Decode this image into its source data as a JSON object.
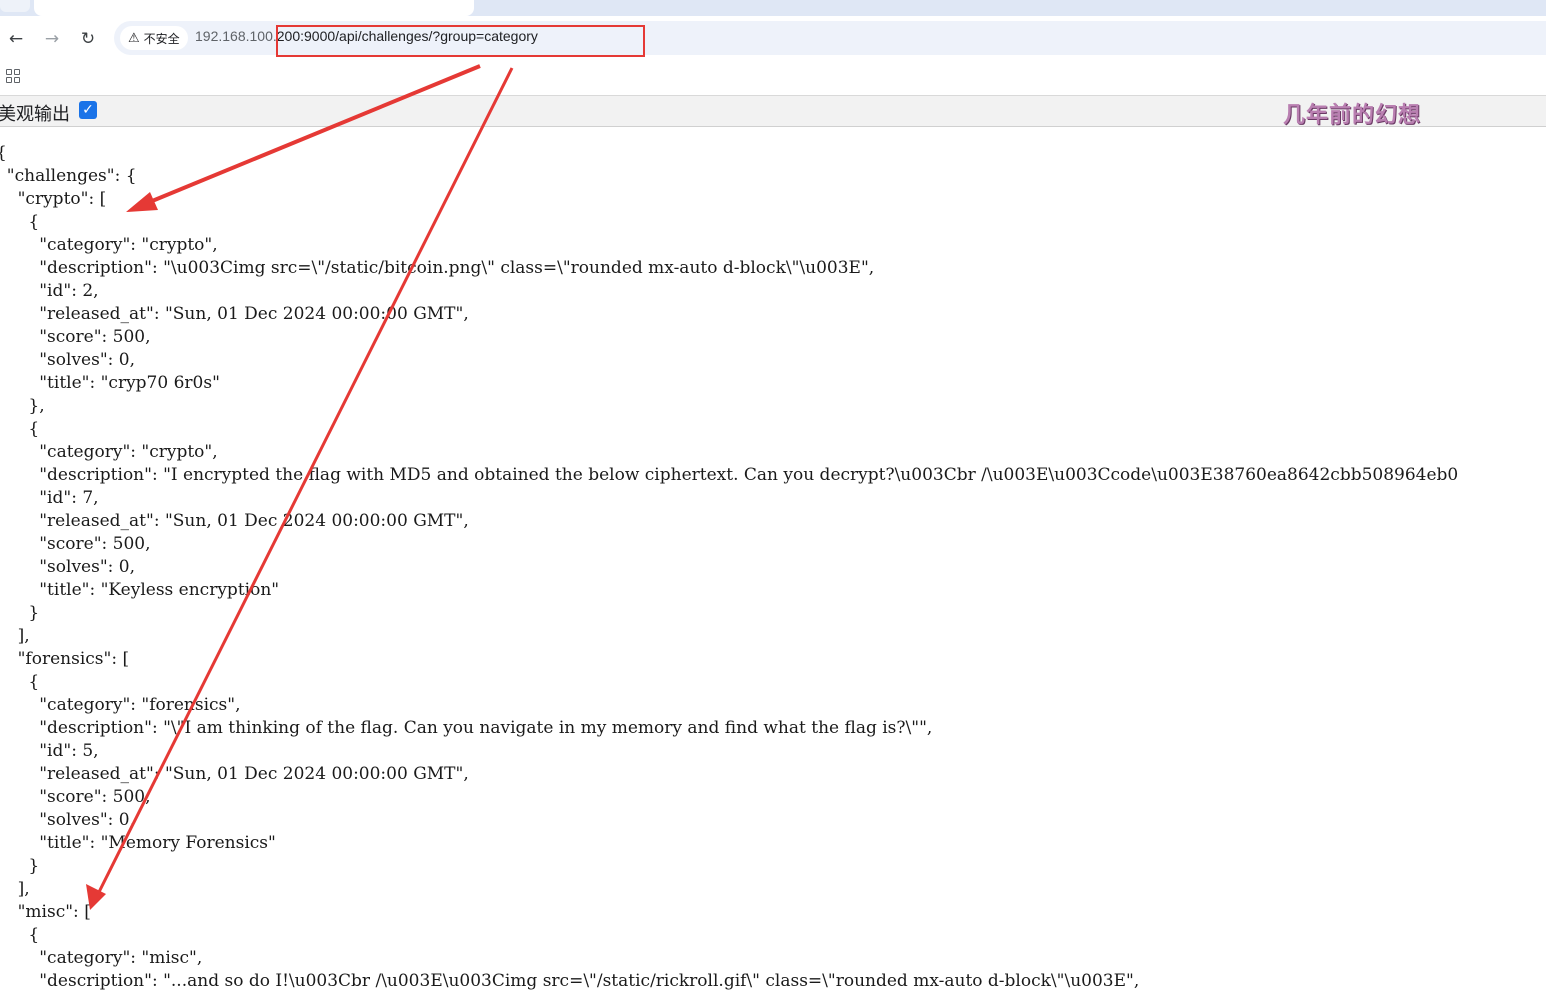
{
  "browser": {
    "security_icon": "warning-triangle-icon",
    "security_label": "不安全",
    "url_host": "192.168.100.",
    "url_rest": "200:9000/api/challenges/?group=category"
  },
  "pretty_print": {
    "label": "美观输出",
    "checked": true
  },
  "watermark": "几年前的幻想",
  "json_lines": [
    "{",
    "  \"challenges\": {",
    "    \"crypto\": [",
    "      {",
    "        \"category\": \"crypto\",",
    "        \"description\": \"\\u003Cimg src=\\\"/static/bitcoin.png\\\" class=\\\"rounded mx-auto d-block\\\"\\u003E\",",
    "        \"id\": 2,",
    "        \"released_at\": \"Sun, 01 Dec 2024 00:00:00 GMT\",",
    "        \"score\": 500,",
    "        \"solves\": 0,",
    "        \"title\": \"cryp70 6r0s\"",
    "      },",
    "      {",
    "        \"category\": \"crypto\",",
    "        \"description\": \"I encrypted the flag with MD5 and obtained the below ciphertext. Can you decrypt?\\u003Cbr /\\u003E\\u003Ccode\\u003E38760ea8642cbb508964eb0",
    "        \"id\": 7,",
    "        \"released_at\": \"Sun, 01 Dec 2024 00:00:00 GMT\",",
    "        \"score\": 500,",
    "        \"solves\": 0,",
    "        \"title\": \"Keyless encryption\"",
    "      }",
    "    ],",
    "    \"forensics\": [",
    "      {",
    "        \"category\": \"forensics\",",
    "        \"description\": \"\\\"I am thinking of the flag. Can you navigate in my memory and find what the flag is?\\\"\",",
    "        \"id\": 5,",
    "        \"released_at\": \"Sun, 01 Dec 2024 00:00:00 GMT\",",
    "        \"score\": 500,",
    "        \"solves\": 0,",
    "        \"title\": \"Memory Forensics\"",
    "      }",
    "    ],",
    "    \"misc\": [",
    "      {",
    "        \"category\": \"misc\",",
    "        \"description\": \"...and so do I!\\u003Cbr /\\u003E\\u003Cimg src=\\\"/static/rickroll.gif\\\" class=\\\"rounded mx-auto d-block\\\"\\u003E\","
  ]
}
